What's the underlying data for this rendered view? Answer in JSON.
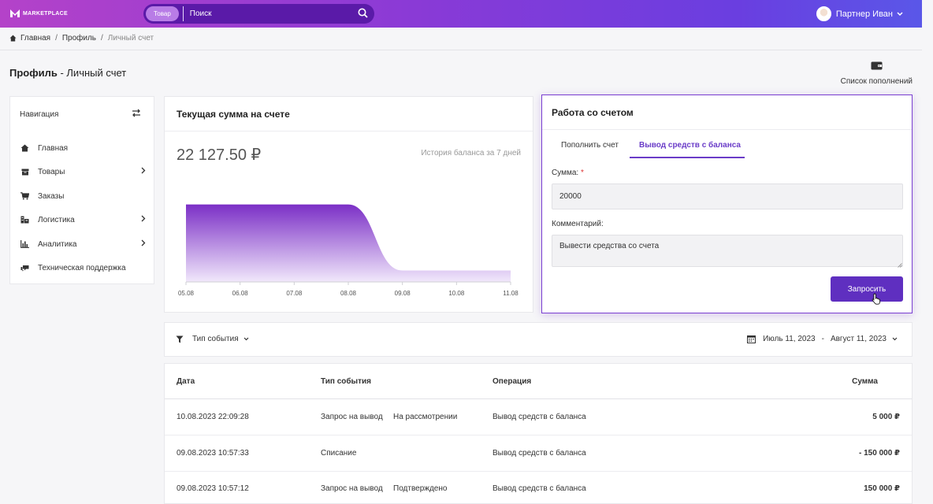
{
  "brand": {
    "name": "MARKETPLACE"
  },
  "header": {
    "search_chip": "Товар",
    "search_placeholder": "Поиск",
    "user_name": "Партнер Иван"
  },
  "breadcrumb": [
    "Главная",
    "Профиль",
    "Личный счет"
  ],
  "page": {
    "title_bold": "Профиль",
    "title_rest": " - Личный счет",
    "refill_list_label": "Список пополнений"
  },
  "nav": {
    "title": "Навигация",
    "items": [
      {
        "label": "Главная",
        "icon": "home-icon",
        "has_arrow": false
      },
      {
        "label": "Товары",
        "icon": "box-icon",
        "has_arrow": true
      },
      {
        "label": "Заказы",
        "icon": "cart-icon",
        "has_arrow": false
      },
      {
        "label": "Логистика",
        "icon": "truck-icon",
        "has_arrow": true
      },
      {
        "label": "Аналитика",
        "icon": "bar-chart-icon",
        "has_arrow": true
      },
      {
        "label": "Техническая поддержка",
        "icon": "support-icon",
        "has_arrow": false
      }
    ]
  },
  "balance": {
    "title": "Текущая сумма на счете",
    "amount": "22 127.50 ₽",
    "history_label": "История баланса за 7 дней"
  },
  "chart_data": {
    "type": "area",
    "categories": [
      "05.08",
      "06.08",
      "07.08",
      "08.08",
      "09.08",
      "10.08",
      "11.08"
    ],
    "values": [
      150000,
      150000,
      150000,
      150000,
      22127.5,
      22127.5,
      22127.5
    ],
    "ylim": [
      0,
      160000
    ],
    "grid": false,
    "color": "#7b2fc6"
  },
  "account": {
    "title": "Работа со счетом",
    "tabs": [
      "Пополнить счет",
      "Вывод средств с баланса"
    ],
    "active_tab": 1,
    "amount_label": "Сумма:",
    "required_mark": "*",
    "amount_value": "20000",
    "comment_label": "Комментарий:",
    "comment_value": "Вывести средства со счета",
    "submit_label": "Запросить",
    "accent": "#5f2fc0"
  },
  "filter": {
    "event_type_label": "Тип события",
    "date_from": "Июль 11, 2023",
    "date_sep": "-",
    "date_to": "Август 11, 2023"
  },
  "table": {
    "headers": [
      "Дата",
      "Тип события",
      "Операция",
      "Сумма"
    ],
    "rows": [
      {
        "date": "10.08.2023 22:09:28",
        "type": "Запрос на вывод",
        "status": "На рассмотрении",
        "status_kind": "pending",
        "operation": "Вывод средств с баланса",
        "sum": "5 000 ₽",
        "sum_kind": "normal"
      },
      {
        "date": "09.08.2023 10:57:33",
        "type": "Списание",
        "status": "",
        "status_kind": "",
        "operation": "Вывод средств с баланса",
        "sum": "- 150 000 ₽",
        "sum_kind": "negative"
      },
      {
        "date": "09.08.2023 10:57:12",
        "type": "Запрос на вывод",
        "status": "Подтверждено",
        "status_kind": "ok",
        "operation": "Вывод средств с баланса",
        "sum": "150 000 ₽",
        "sum_kind": "normal"
      }
    ]
  }
}
